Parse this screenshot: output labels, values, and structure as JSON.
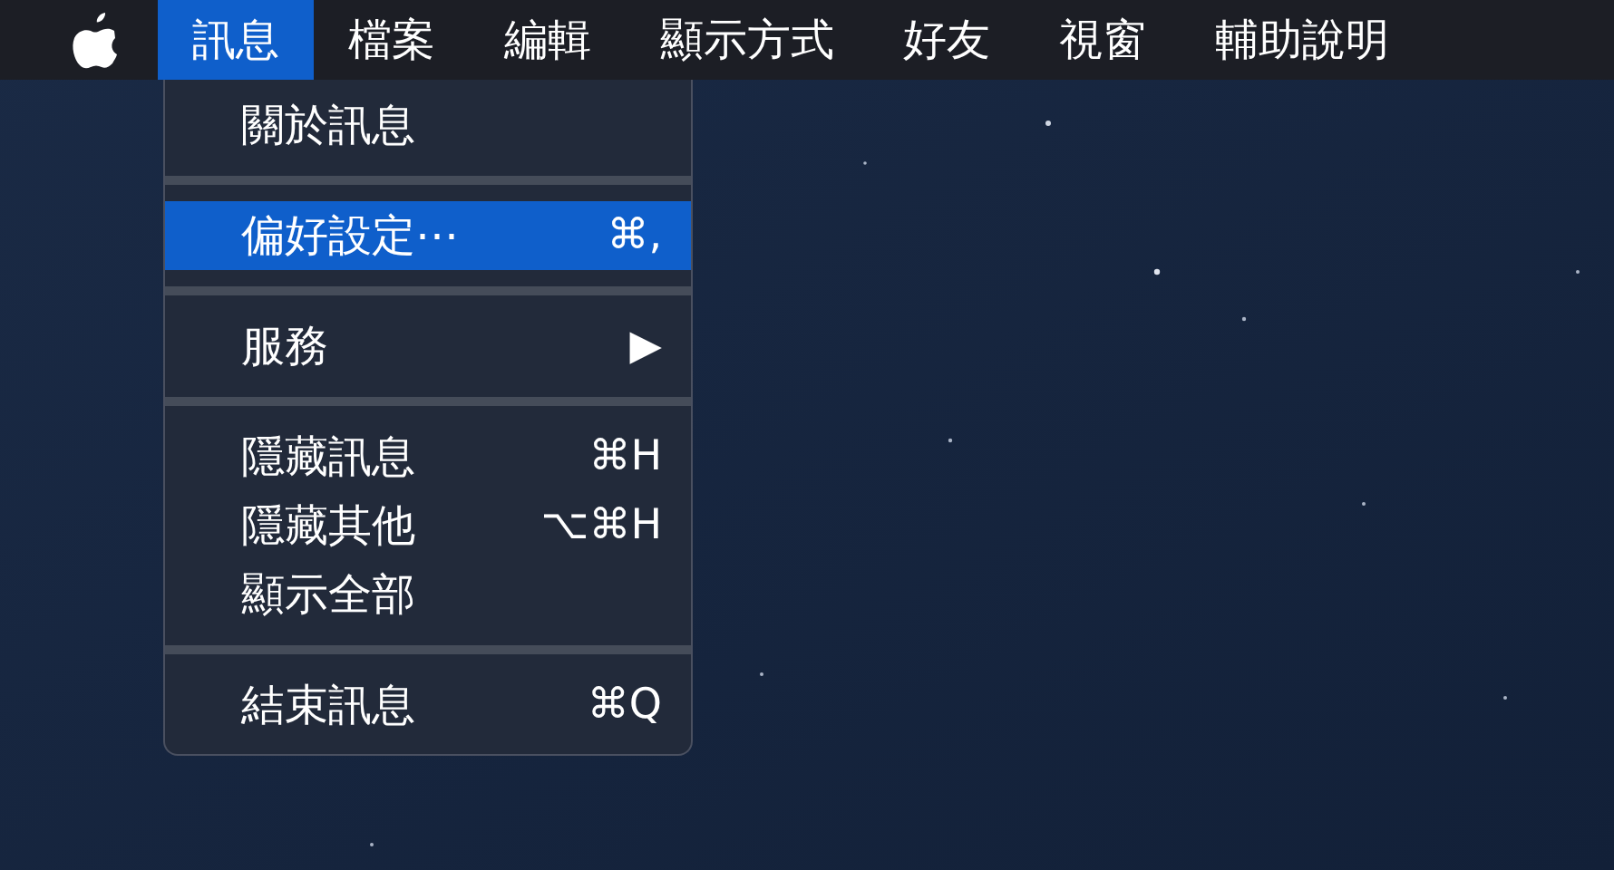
{
  "menu_bar": [
    {
      "label": "訊息",
      "selected": true
    },
    {
      "label": "檔案",
      "selected": false
    },
    {
      "label": "編輯",
      "selected": false
    },
    {
      "label": "顯示方式",
      "selected": false
    },
    {
      "label": "好友",
      "selected": false
    },
    {
      "label": "視窗",
      "selected": false
    },
    {
      "label": "輔助說明",
      "selected": false
    }
  ],
  "menu": {
    "items": [
      {
        "kind": "item",
        "label": "關於訊息",
        "selected": false
      },
      {
        "kind": "separator"
      },
      {
        "kind": "item",
        "label": "偏好設定⋯",
        "shortcut": "⌘,",
        "selected": true
      },
      {
        "kind": "separator"
      },
      {
        "kind": "item",
        "label": "服務",
        "submenu": "▶",
        "selected": false
      },
      {
        "kind": "separator"
      },
      {
        "kind": "item",
        "label": "隱藏訊息",
        "shortcut": "⌘H",
        "selected": false
      },
      {
        "kind": "item",
        "label": "隱藏其他",
        "shortcut": "⌥⌘H",
        "selected": false
      },
      {
        "kind": "item",
        "label": "顯示全部",
        "selected": false
      },
      {
        "kind": "separator"
      },
      {
        "kind": "item",
        "label": "結束訊息",
        "shortcut": "⌘Q",
        "selected": false
      }
    ]
  }
}
